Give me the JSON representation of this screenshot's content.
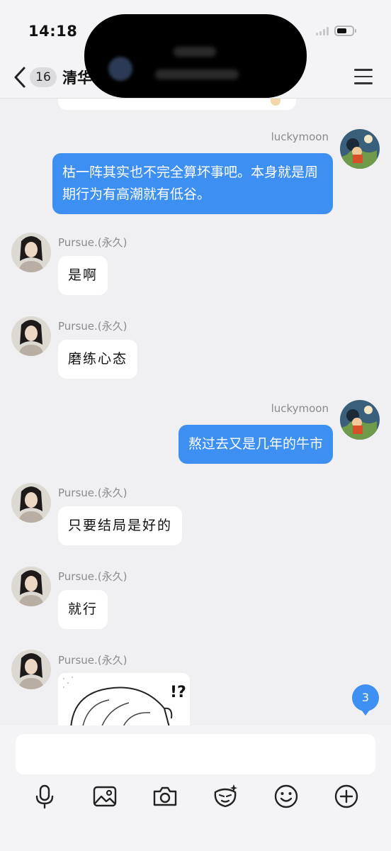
{
  "status_bar": {
    "time": "14:18"
  },
  "header": {
    "unread_count": "16",
    "title": "清华"
  },
  "messages": [
    {
      "direction": "out",
      "sender": "luckymoon",
      "text": "枯一阵其实也不完全算坏事吧。本身就是周期行为有高潮就有低谷。"
    },
    {
      "direction": "in",
      "sender": "Pursue.(永久)",
      "text": "是啊"
    },
    {
      "direction": "in",
      "sender": "Pursue.(永久)",
      "text": "磨练心态"
    },
    {
      "direction": "out",
      "sender": "luckymoon",
      "text": "熬过去又是几年的牛市"
    },
    {
      "direction": "in",
      "sender": "Pursue.(永久)",
      "text": "只要结局是好的"
    },
    {
      "direction": "in",
      "sender": "Pursue.(永久)",
      "text": "就行"
    },
    {
      "direction": "in",
      "sender": "Pursue.(永久)",
      "text": "",
      "sticker_text": "!?"
    }
  ],
  "new_message_badge": "3",
  "composer": {
    "input_value": ""
  },
  "toolbar": [
    {
      "icon": "microphone-icon"
    },
    {
      "icon": "image-icon"
    },
    {
      "icon": "camera-icon"
    },
    {
      "icon": "sticker-icon"
    },
    {
      "icon": "emoji-icon"
    },
    {
      "icon": "plus-icon"
    }
  ],
  "colors": {
    "outgoing_bubble": "#3d8ff2",
    "incoming_bubble": "#ffffff",
    "background": "#f0f0f2"
  }
}
